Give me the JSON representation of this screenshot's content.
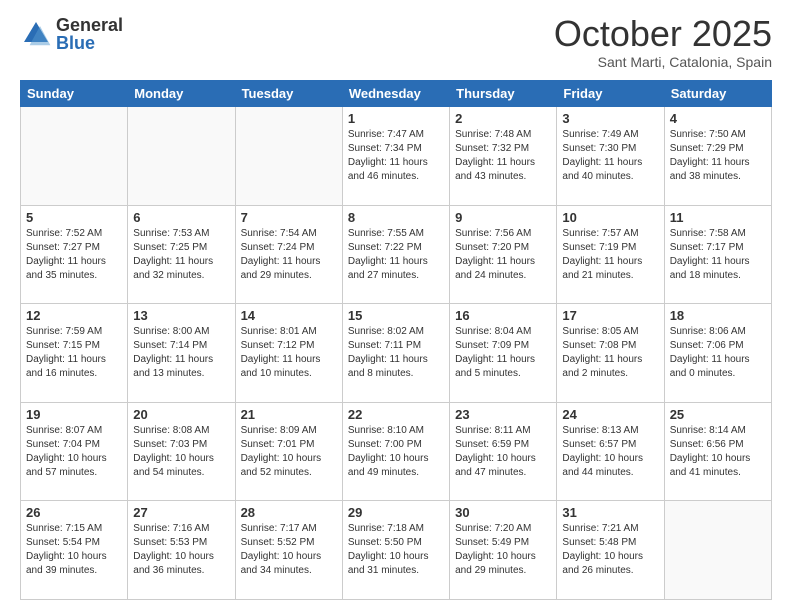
{
  "header": {
    "logo_general": "General",
    "logo_blue": "Blue",
    "month_title": "October 2025",
    "location": "Sant Marti, Catalonia, Spain"
  },
  "days_of_week": [
    "Sunday",
    "Monday",
    "Tuesday",
    "Wednesday",
    "Thursday",
    "Friday",
    "Saturday"
  ],
  "weeks": [
    [
      {
        "day": "",
        "info": ""
      },
      {
        "day": "",
        "info": ""
      },
      {
        "day": "",
        "info": ""
      },
      {
        "day": "1",
        "info": "Sunrise: 7:47 AM\nSunset: 7:34 PM\nDaylight: 11 hours and 46 minutes."
      },
      {
        "day": "2",
        "info": "Sunrise: 7:48 AM\nSunset: 7:32 PM\nDaylight: 11 hours and 43 minutes."
      },
      {
        "day": "3",
        "info": "Sunrise: 7:49 AM\nSunset: 7:30 PM\nDaylight: 11 hours and 40 minutes."
      },
      {
        "day": "4",
        "info": "Sunrise: 7:50 AM\nSunset: 7:29 PM\nDaylight: 11 hours and 38 minutes."
      }
    ],
    [
      {
        "day": "5",
        "info": "Sunrise: 7:52 AM\nSunset: 7:27 PM\nDaylight: 11 hours and 35 minutes."
      },
      {
        "day": "6",
        "info": "Sunrise: 7:53 AM\nSunset: 7:25 PM\nDaylight: 11 hours and 32 minutes."
      },
      {
        "day": "7",
        "info": "Sunrise: 7:54 AM\nSunset: 7:24 PM\nDaylight: 11 hours and 29 minutes."
      },
      {
        "day": "8",
        "info": "Sunrise: 7:55 AM\nSunset: 7:22 PM\nDaylight: 11 hours and 27 minutes."
      },
      {
        "day": "9",
        "info": "Sunrise: 7:56 AM\nSunset: 7:20 PM\nDaylight: 11 hours and 24 minutes."
      },
      {
        "day": "10",
        "info": "Sunrise: 7:57 AM\nSunset: 7:19 PM\nDaylight: 11 hours and 21 minutes."
      },
      {
        "day": "11",
        "info": "Sunrise: 7:58 AM\nSunset: 7:17 PM\nDaylight: 11 hours and 18 minutes."
      }
    ],
    [
      {
        "day": "12",
        "info": "Sunrise: 7:59 AM\nSunset: 7:15 PM\nDaylight: 11 hours and 16 minutes."
      },
      {
        "day": "13",
        "info": "Sunrise: 8:00 AM\nSunset: 7:14 PM\nDaylight: 11 hours and 13 minutes."
      },
      {
        "day": "14",
        "info": "Sunrise: 8:01 AM\nSunset: 7:12 PM\nDaylight: 11 hours and 10 minutes."
      },
      {
        "day": "15",
        "info": "Sunrise: 8:02 AM\nSunset: 7:11 PM\nDaylight: 11 hours and 8 minutes."
      },
      {
        "day": "16",
        "info": "Sunrise: 8:04 AM\nSunset: 7:09 PM\nDaylight: 11 hours and 5 minutes."
      },
      {
        "day": "17",
        "info": "Sunrise: 8:05 AM\nSunset: 7:08 PM\nDaylight: 11 hours and 2 minutes."
      },
      {
        "day": "18",
        "info": "Sunrise: 8:06 AM\nSunset: 7:06 PM\nDaylight: 11 hours and 0 minutes."
      }
    ],
    [
      {
        "day": "19",
        "info": "Sunrise: 8:07 AM\nSunset: 7:04 PM\nDaylight: 10 hours and 57 minutes."
      },
      {
        "day": "20",
        "info": "Sunrise: 8:08 AM\nSunset: 7:03 PM\nDaylight: 10 hours and 54 minutes."
      },
      {
        "day": "21",
        "info": "Sunrise: 8:09 AM\nSunset: 7:01 PM\nDaylight: 10 hours and 52 minutes."
      },
      {
        "day": "22",
        "info": "Sunrise: 8:10 AM\nSunset: 7:00 PM\nDaylight: 10 hours and 49 minutes."
      },
      {
        "day": "23",
        "info": "Sunrise: 8:11 AM\nSunset: 6:59 PM\nDaylight: 10 hours and 47 minutes."
      },
      {
        "day": "24",
        "info": "Sunrise: 8:13 AM\nSunset: 6:57 PM\nDaylight: 10 hours and 44 minutes."
      },
      {
        "day": "25",
        "info": "Sunrise: 8:14 AM\nSunset: 6:56 PM\nDaylight: 10 hours and 41 minutes."
      }
    ],
    [
      {
        "day": "26",
        "info": "Sunrise: 7:15 AM\nSunset: 5:54 PM\nDaylight: 10 hours and 39 minutes."
      },
      {
        "day": "27",
        "info": "Sunrise: 7:16 AM\nSunset: 5:53 PM\nDaylight: 10 hours and 36 minutes."
      },
      {
        "day": "28",
        "info": "Sunrise: 7:17 AM\nSunset: 5:52 PM\nDaylight: 10 hours and 34 minutes."
      },
      {
        "day": "29",
        "info": "Sunrise: 7:18 AM\nSunset: 5:50 PM\nDaylight: 10 hours and 31 minutes."
      },
      {
        "day": "30",
        "info": "Sunrise: 7:20 AM\nSunset: 5:49 PM\nDaylight: 10 hours and 29 minutes."
      },
      {
        "day": "31",
        "info": "Sunrise: 7:21 AM\nSunset: 5:48 PM\nDaylight: 10 hours and 26 minutes."
      },
      {
        "day": "",
        "info": ""
      }
    ]
  ]
}
